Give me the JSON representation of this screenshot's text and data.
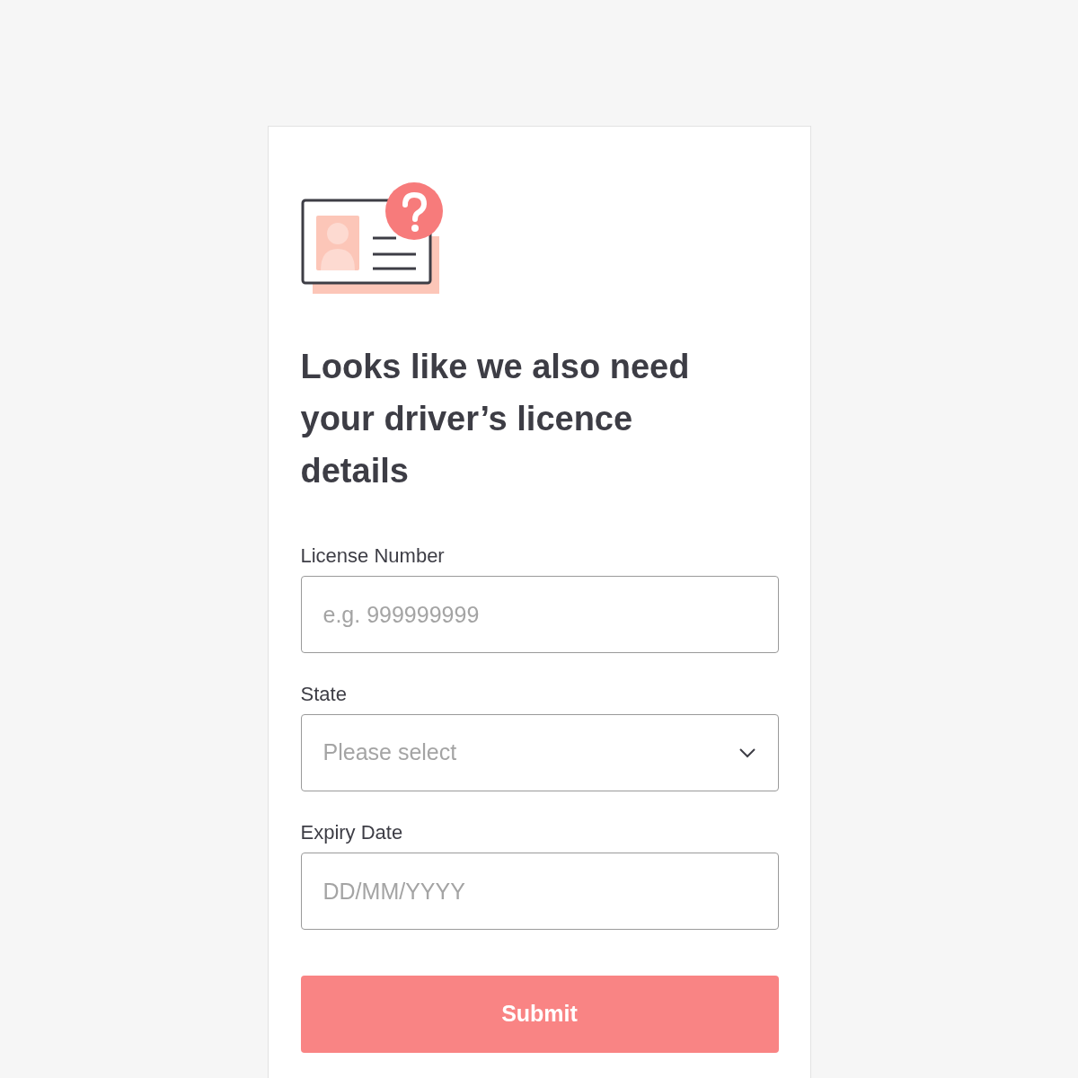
{
  "heading": "Looks like we also need your driver’s licence details",
  "fields": [
    {
      "kind": "text",
      "label": "License Number",
      "placeholder": "e.g. 999999999"
    },
    {
      "kind": "select",
      "label": "State",
      "placeholder": "Please select"
    },
    {
      "kind": "text",
      "label": "Expiry Date",
      "placeholder": "DD/MM/YYYY"
    }
  ],
  "submit": "Submit"
}
